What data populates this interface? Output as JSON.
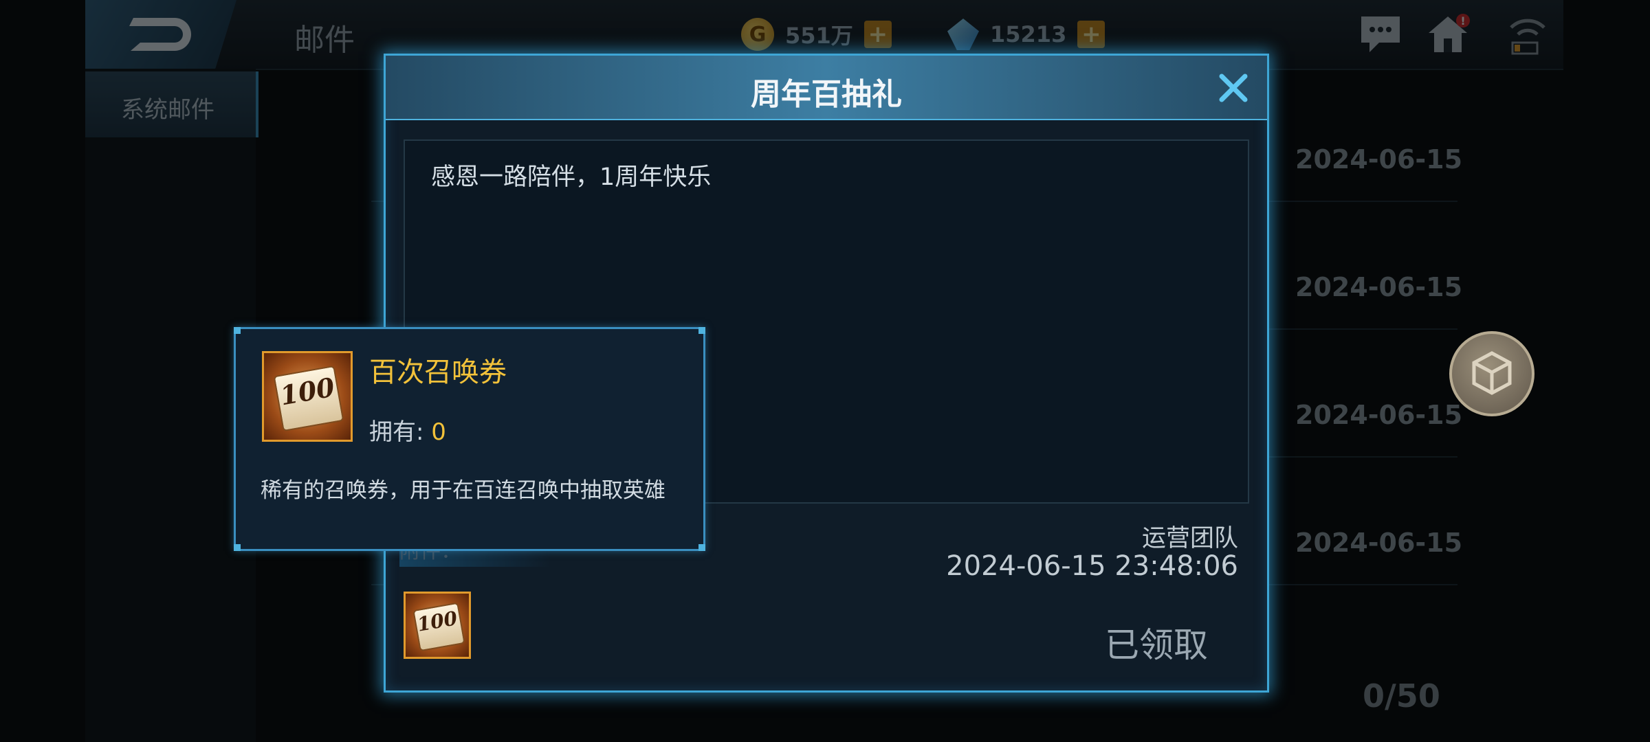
{
  "header": {
    "title": "邮件",
    "gold": "551万",
    "gems": "15213",
    "plus": "+",
    "coin_symbol": "G",
    "alert_mark": "!"
  },
  "tabs": {
    "system_mail": "系统邮件"
  },
  "mail_list": {
    "dates": [
      "2024-06-15",
      "2024-06-15",
      "2024-06-15",
      "2024-06-15"
    ],
    "count": "0/50"
  },
  "dialog": {
    "title": "周年百抽礼",
    "message": "感恩一路陪伴，1周年快乐",
    "sender": "运营团队",
    "sent_time": "2024-06-15 23:48:06",
    "attachments_label": "附件：",
    "claim_status": "已领取"
  },
  "item": {
    "name": "百次召唤券",
    "owned_label": "拥有: ",
    "owned_value": "0",
    "description": "稀有的召唤券，用于在百连召唤中抽取英雄",
    "icon_number": "100"
  },
  "colors": {
    "accent": "#3ea6d6",
    "highlight": "#f3c23a",
    "item_border": "#e19a2c"
  }
}
